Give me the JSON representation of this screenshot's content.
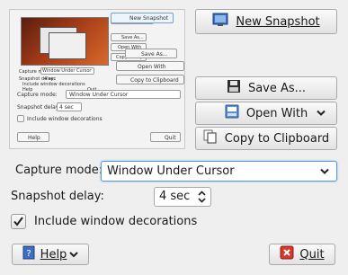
{
  "preview": {
    "mini_labels": {
      "new_snapshot": "New Snapshot",
      "save_as": "Save As...",
      "open_with": "Open With",
      "copy": "Copy to Clipboard",
      "capture_mode": "Capture mode:",
      "capture_value": "Window Under Cursor",
      "delay": "Snapshot delay:",
      "delay_value": "4 sec",
      "include": "Include window decorations",
      "help": "Help",
      "quit": "Quit"
    }
  },
  "buttons": {
    "new_snapshot": "New Snapshot",
    "save_as": "Save As...",
    "open_with": "Open With",
    "copy_clipboard": "Copy to Clipboard"
  },
  "form": {
    "capture_mode_label": "Capture mode:",
    "capture_mode_value": "Window Under Cursor",
    "delay_label": "Snapshot delay:",
    "delay_value": "4 sec",
    "include_decorations_label": "Include window decorations",
    "include_decorations_checked": true
  },
  "footer": {
    "help": "Help",
    "quit": "Quit"
  },
  "icons": {
    "new_snapshot": "screenshot-icon",
    "save_as": "floppy-disk-icon",
    "open_with": "open-with-icon",
    "copy": "copy-icon",
    "help": "help-book-icon",
    "quit": "quit-icon"
  },
  "colors": {
    "focus_border": "#5b9bd9",
    "quit_red": "#d33a2c",
    "help_blue": "#3a6fc4"
  }
}
